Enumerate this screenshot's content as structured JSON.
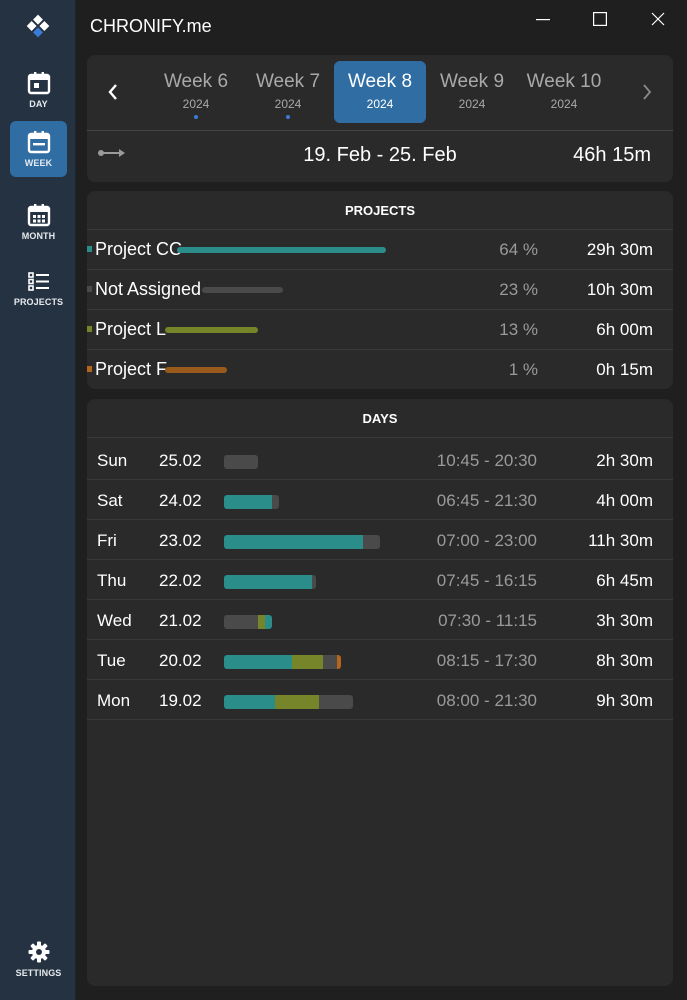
{
  "app": {
    "title": "CHRONIFY.me"
  },
  "sidebar": {
    "items": [
      {
        "label": "DAY",
        "icon": "calendar-day-icon"
      },
      {
        "label": "WEEK",
        "icon": "calendar-week-icon"
      },
      {
        "label": "MONTH",
        "icon": "calendar-month-icon"
      },
      {
        "label": "PROJECTS",
        "icon": "list-icon"
      }
    ],
    "settings": {
      "label": "SETTINGS",
      "icon": "gear-icon"
    }
  },
  "weeks": {
    "tabs": [
      {
        "label": "Week 6",
        "year": "2024"
      },
      {
        "label": "Week 7",
        "year": "2024"
      },
      {
        "label": "Week 8",
        "year": "2024"
      },
      {
        "label": "Week 9",
        "year": "2024"
      },
      {
        "label": "Week 10",
        "year": "2024"
      }
    ],
    "date_range": "19. Feb - 25. Feb",
    "total": "46h 15m"
  },
  "projects": {
    "title": "PROJECTS",
    "rows": [
      {
        "name": "Project CC",
        "percent": "64 %",
        "duration": "29h 30m",
        "color": "#2b8d8a",
        "share": 0.64
      },
      {
        "name": "Not Assigned",
        "percent": "23 %",
        "duration": "10h 30m",
        "color": "#4a4a4a",
        "share": 0.23
      },
      {
        "name": "Project L",
        "percent": "13 %",
        "duration": "6h 00m",
        "color": "#77852a",
        "share": 0.13
      },
      {
        "name": "Project F",
        "percent": "1 %",
        "duration": "0h 15m",
        "color": "#b5651d",
        "share": 0.01
      }
    ]
  },
  "days": {
    "title": "DAYS",
    "rows": [
      {
        "day": "Sun",
        "date": "25.02",
        "span": "10:45 - 20:30",
        "duration": "2h 30m",
        "hours": {
          "cc": 0,
          "l": 0,
          "na": 2.5,
          "f": 0
        }
      },
      {
        "day": "Sat",
        "date": "24.02",
        "span": "06:45 - 21:30",
        "duration": "4h 00m",
        "hours": {
          "cc": 3.5,
          "l": 0,
          "na": 0.5,
          "f": 0
        }
      },
      {
        "day": "Fri",
        "date": "23.02",
        "span": "07:00 - 23:00",
        "duration": "11h 30m",
        "hours": {
          "cc": 10.25,
          "l": 0,
          "na": 1.25,
          "f": 0
        }
      },
      {
        "day": "Thu",
        "date": "22.02",
        "span": "07:45 - 16:15",
        "duration": "6h 45m",
        "hours": {
          "cc": 6.5,
          "l": 0,
          "na": 0.25,
          "f": 0
        }
      },
      {
        "day": "Wed",
        "date": "21.02",
        "span": "07:30 - 11:15",
        "duration": "3h 30m",
        "hours": {
          "cc": 0.5,
          "l": 0.5,
          "na": 2.5,
          "f": 0
        }
      },
      {
        "day": "Tue",
        "date": "20.02",
        "span": "08:15 - 17:30",
        "duration": "8h 30m",
        "hours": {
          "cc": 5.0,
          "l": 2.25,
          "na": 1.0,
          "f": 0.25
        }
      },
      {
        "day": "Mon",
        "date": "19.02",
        "span": "08:00 - 21:30",
        "duration": "9h 30m",
        "hours": {
          "cc": 3.75,
          "l": 3.25,
          "na": 2.5,
          "f": 0
        }
      }
    ]
  },
  "colors": {
    "cc": "#2b8d8a",
    "l": "#77852a",
    "na": "#4a4a4a",
    "f": "#b5651d",
    "accent": "#2f6da3"
  }
}
